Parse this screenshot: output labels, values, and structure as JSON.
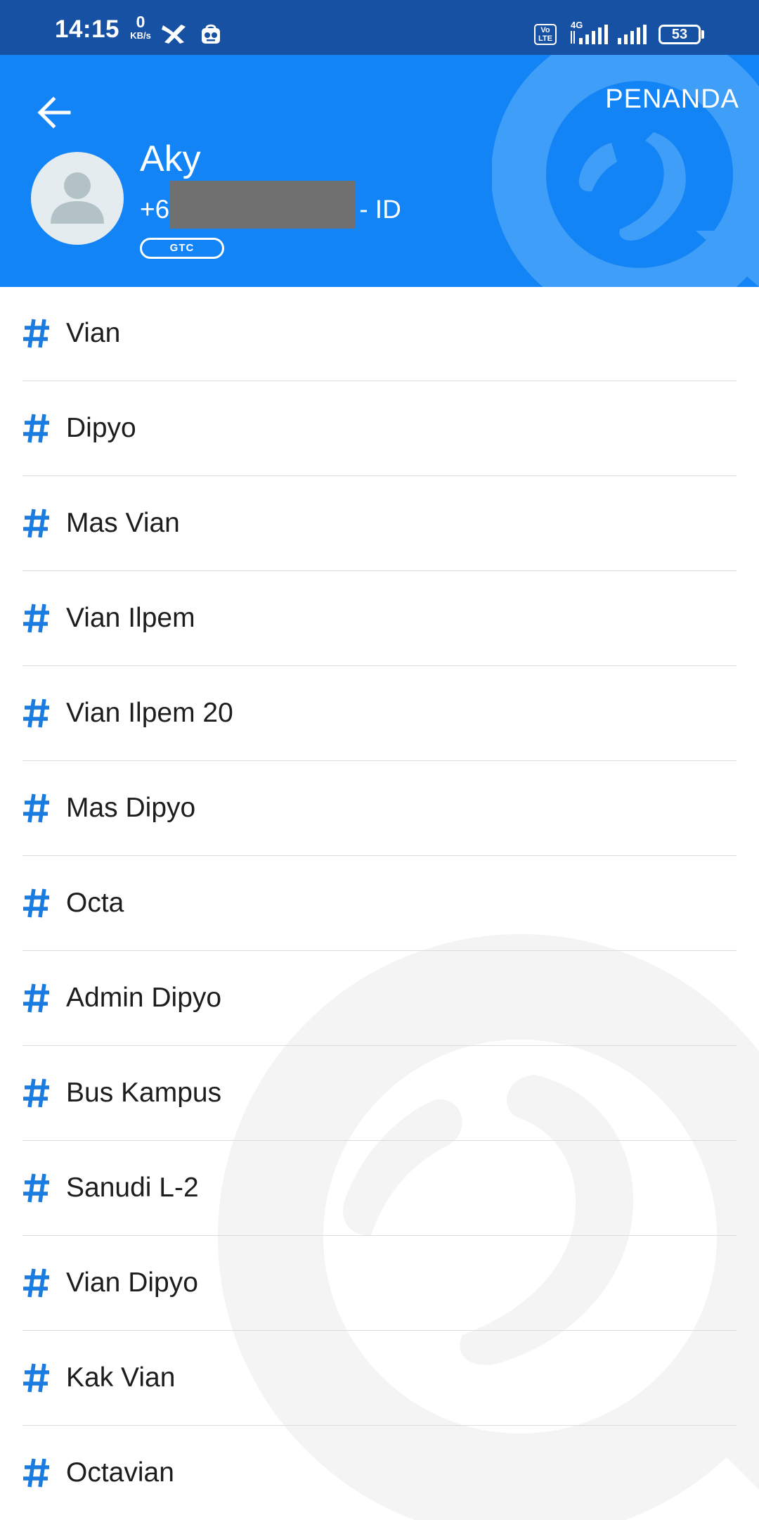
{
  "status_bar": {
    "time": "14:15",
    "speed_value": "0",
    "speed_unit": "KB/s",
    "volte_label": "Vo LTE",
    "network_type": "4G",
    "battery_level": "53"
  },
  "header": {
    "penanda_label": "PENANDA",
    "contact_name": "Aky",
    "phone_prefix": "+6",
    "phone_suffix": "- ID",
    "carrier_badge": "GTC",
    "background_color": "#1384f5"
  },
  "tags": [
    {
      "label": "Vian"
    },
    {
      "label": "Dipyo"
    },
    {
      "label": "Mas Vian"
    },
    {
      "label": "Vian Ilpem"
    },
    {
      "label": "Vian Ilpem 20"
    },
    {
      "label": "Mas Dipyo"
    },
    {
      "label": "Octa"
    },
    {
      "label": "Admin Dipyo"
    },
    {
      "label": "Bus Kampus"
    },
    {
      "label": "Sanudi L-2"
    },
    {
      "label": "Vian Dipyo"
    },
    {
      "label": "Kak Vian"
    },
    {
      "label": "Octavian"
    }
  ],
  "colors": {
    "accent": "#1384f5",
    "status_bar": "#1751a3",
    "hash_icon": "#1a7be0"
  }
}
